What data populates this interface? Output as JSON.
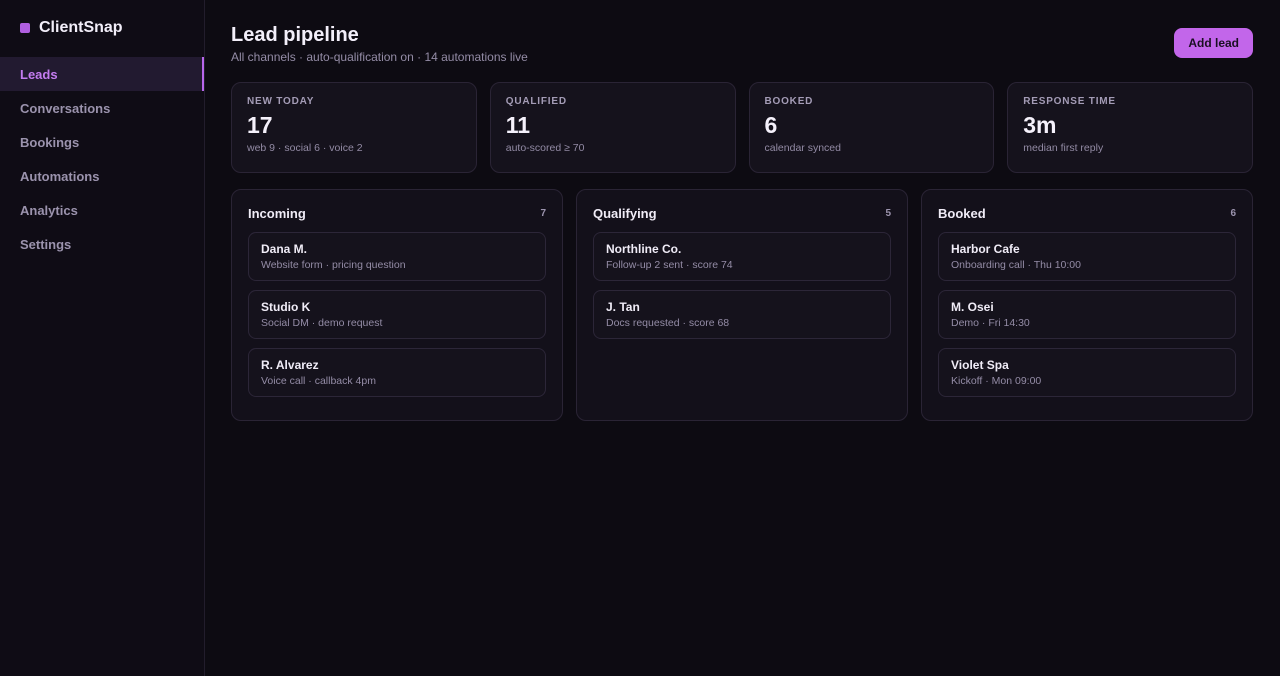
{
  "brand": {
    "name": "ClientSnap",
    "accent": "#c266ea"
  },
  "sidebar": {
    "items": [
      {
        "label": "Leads",
        "active": true
      },
      {
        "label": "Conversations",
        "active": false
      },
      {
        "label": "Bookings",
        "active": false
      },
      {
        "label": "Automations",
        "active": false
      },
      {
        "label": "Analytics",
        "active": false
      },
      {
        "label": "Settings",
        "active": false
      }
    ]
  },
  "header": {
    "title": "Lead pipeline",
    "subtitle": "All channels · auto-qualification on · 14 automations live",
    "add_button": "Add lead"
  },
  "stats": [
    {
      "label": "NEW TODAY",
      "value": "17",
      "note": "web 9 · social 6 · voice 2"
    },
    {
      "label": "QUALIFIED",
      "value": "11",
      "note": "auto-scored ≥ 70"
    },
    {
      "label": "BOOKED",
      "value": "6",
      "note": "calendar synced"
    },
    {
      "label": "RESPONSE TIME",
      "value": "3m",
      "note": "median first reply"
    }
  ],
  "columns": [
    {
      "title": "Incoming",
      "count": "7",
      "cards": [
        {
          "name": "Dana M.",
          "meta": "Website form · pricing question"
        },
        {
          "name": "Studio K",
          "meta": "Social DM · demo request"
        },
        {
          "name": "R. Alvarez",
          "meta": "Voice call · callback 4pm"
        }
      ]
    },
    {
      "title": "Qualifying",
      "count": "5",
      "cards": [
        {
          "name": "Northline Co.",
          "meta": "Follow-up 2 sent · score 74"
        },
        {
          "name": "J. Tan",
          "meta": "Docs requested · score 68"
        }
      ]
    },
    {
      "title": "Booked",
      "count": "6",
      "cards": [
        {
          "name": "Harbor Cafe",
          "meta": "Onboarding call · Thu 10:00"
        },
        {
          "name": "M. Osei",
          "meta": "Demo · Fri 14:30"
        },
        {
          "name": "Violet Spa",
          "meta": "Kickoff · Mon 09:00"
        }
      ]
    }
  ]
}
